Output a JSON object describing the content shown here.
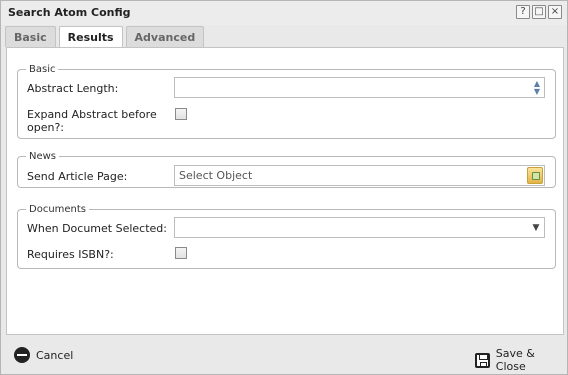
{
  "window": {
    "title": "Search Atom Config",
    "buttons": {
      "help": "?",
      "maximize": "□",
      "close": "×"
    }
  },
  "tabs": [
    {
      "label": "Basic",
      "active": false
    },
    {
      "label": "Results",
      "active": true
    },
    {
      "label": "Advanced",
      "active": false
    }
  ],
  "groups": {
    "basic": {
      "legend": "Basic",
      "abstract_length_label": "Abstract Length:",
      "abstract_length_value": "",
      "expand_abstract_label": "Expand Abstract before open?:",
      "expand_abstract_checked": false
    },
    "news": {
      "legend": "News",
      "send_article_page_label": "Send Article Page:",
      "send_article_page_placeholder": "Select Object"
    },
    "documents": {
      "legend": "Documents",
      "when_selected_label": "When Documet Selected:",
      "when_selected_value": "",
      "requires_isbn_label": "Requires ISBN?:",
      "requires_isbn_checked": false
    }
  },
  "footer": {
    "cancel_label": "Cancel",
    "save_close_label": "Save & Close"
  },
  "icons": {
    "cancel": "minus-circle-icon",
    "save": "floppy-disk-icon",
    "picker": "object-picker-icon"
  }
}
